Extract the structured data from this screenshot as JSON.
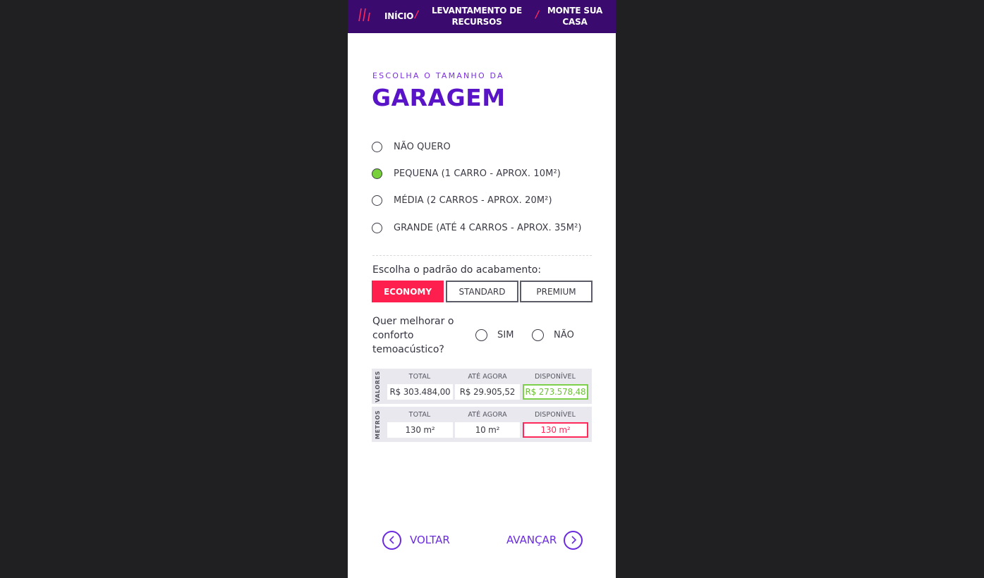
{
  "nav": {
    "items": [
      {
        "label_line1": "INÍCIO",
        "label_line2": ""
      },
      {
        "label_line1": "LEVANTAMENTO DE",
        "label_line2": "RECURSOS"
      },
      {
        "label_line1": "MONTE SUA",
        "label_line2": "CASA"
      }
    ],
    "separator": "/"
  },
  "heading": {
    "eyebrow": "ESCOLHA O TAMANHO DA",
    "title": "GARAGEM"
  },
  "size_options": [
    {
      "label": "NÃO QUERO",
      "checked": false
    },
    {
      "label": "PEQUENA (1 CARRO - APROX. 10M²)",
      "checked": true
    },
    {
      "label": "MÉDIA (2 CARROS - APROX. 20M²)",
      "checked": false
    },
    {
      "label": "GRANDE (ATÉ 4 CARROS - APROX. 35M²)",
      "checked": false
    }
  ],
  "finish": {
    "question": "Escolha o padrão do acabamento:",
    "options": [
      "ECONOMY",
      "STANDARD",
      "PREMIUM"
    ],
    "selected": "ECONOMY"
  },
  "comfort": {
    "question_lines": [
      "Quer melhorar o",
      "conforto",
      "temoacústico?"
    ],
    "yes": "SIM",
    "no": "NÃO"
  },
  "values_table": {
    "side_label": "VALORES",
    "headers": [
      "TOTAL",
      "ATÉ AGORA",
      "DISPONÍVEL"
    ],
    "cells": [
      "R$ 303.484,00",
      "R$ 29.905,52",
      "R$ 273.578,48"
    ]
  },
  "meters_table": {
    "side_label": "METROS",
    "headers": [
      "TOTAL",
      "ATÉ AGORA",
      "DISPONÍVEL"
    ],
    "cells": [
      "130 m²",
      "10 m²",
      "130 m²"
    ]
  },
  "footer": {
    "back": "VOLTAR",
    "next": "AVANÇAR"
  },
  "colors": {
    "nav_bg": "#3a0a6e",
    "accent_purple": "#5a14c8",
    "accent_red": "#ff1f4e",
    "accent_green": "#78d13a"
  }
}
